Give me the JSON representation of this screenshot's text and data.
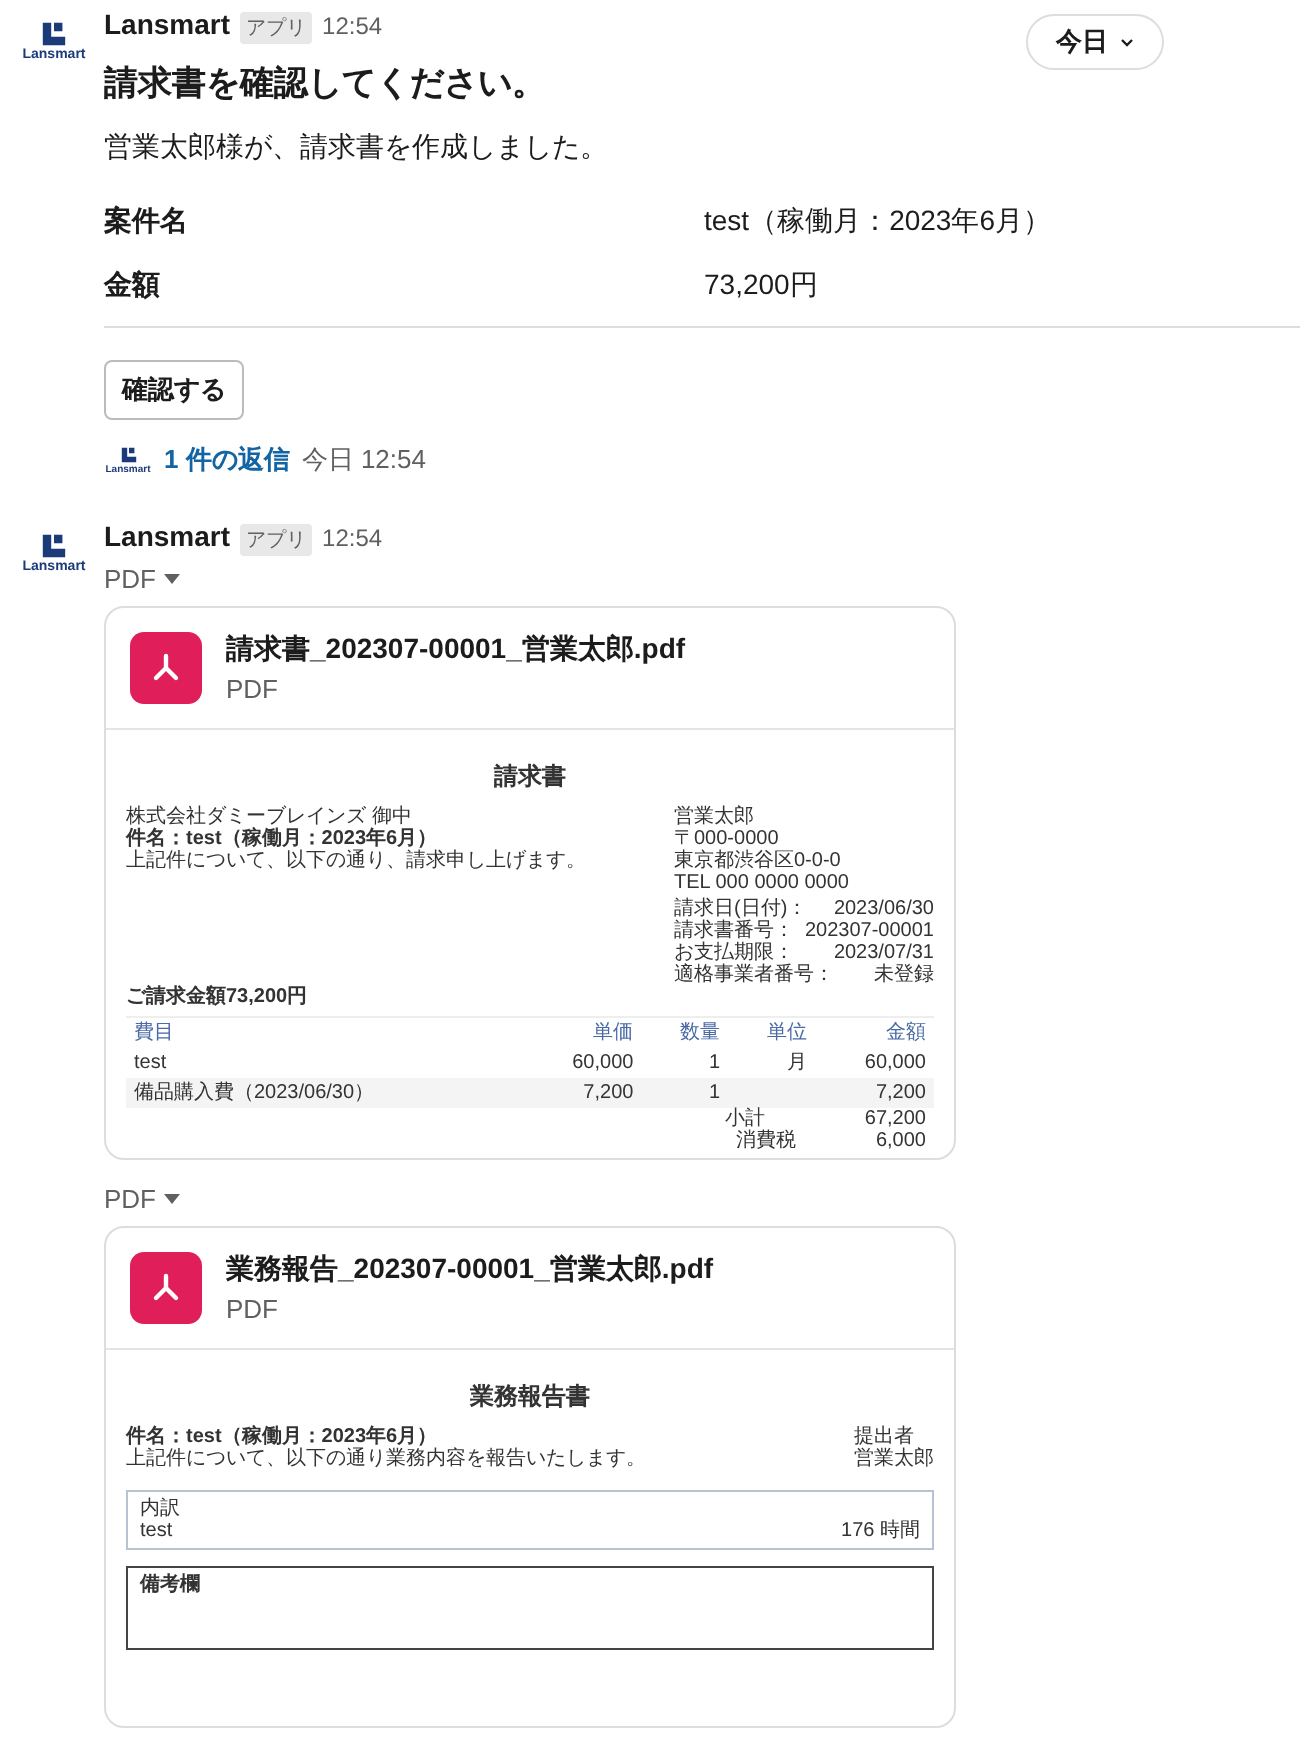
{
  "date_divider": {
    "label": "今日"
  },
  "messages": [
    {
      "sender": "Lansmart",
      "badge": "アプリ",
      "time": "12:54",
      "avatar_text": "Lansmart",
      "title": "請求書を確認してください。",
      "body": "営業太郎様が、請求書を作成しました。",
      "fields": [
        {
          "label": "案件名",
          "value": "test（稼働月：2023年6月）"
        },
        {
          "label": "金額",
          "value": "73,200円"
        }
      ],
      "button": "確認する",
      "thread": {
        "avatar_text": "Lansmart",
        "replies": "1 件の返信",
        "time": "今日 12:54"
      }
    },
    {
      "sender": "Lansmart",
      "badge": "アプリ",
      "time": "12:54",
      "avatar_text": "Lansmart",
      "attachments": [
        {
          "group_label": "PDF",
          "name": "請求書_202307-00001_営業太郎.pdf",
          "type": "PDF",
          "preview": {
            "kind": "invoice",
            "title": "請求書",
            "recipient": "株式会社ダミーブレインズ 御中",
            "subject": "件名：test（稼働月：2023年6月）",
            "note": "上記件について、以下の通り、請求申し上げます。",
            "issuer_lines": [
              "営業太郎",
              "〒000-0000",
              "東京都渋谷区0-0-0",
              "TEL 000 0000 0000"
            ],
            "details": [
              {
                "label": "請求日(日付)：",
                "value": "2023/06/30"
              },
              {
                "label": "請求書番号：",
                "value": "202307-00001"
              },
              {
                "label": "お支払期限：",
                "value": "2023/07/31"
              },
              {
                "label": "適格事業者番号：",
                "value": "未登録"
              }
            ],
            "total": "ご請求金額73,200円",
            "columns": [
              "費目",
              "単価",
              "数量",
              "単位",
              "金額"
            ],
            "rows": [
              {
                "item": "test",
                "unit_price": "60,000",
                "quantity": "1",
                "unit": "月",
                "amount": "60,000"
              },
              {
                "item": "備品購入費（2023/06/30）",
                "unit_price": "7,200",
                "quantity": "1",
                "amount": "7,200"
              }
            ],
            "summary": [
              {
                "label": "小計",
                "value": "67,200"
              },
              {
                "label": "消費税",
                "value": "6,000"
              }
            ]
          }
        },
        {
          "group_label": "PDF",
          "name": "業務報告_202307-00001_営業太郎.pdf",
          "type": "PDF",
          "preview": {
            "kind": "report",
            "title": "業務報告書",
            "subject": "件名：test（稼働月：2023年6月）",
            "note": "上記件について、以下の通り業務内容を報告いたします。",
            "submitter_label": "提出者",
            "submitter": "営業太郎",
            "breakdown_label": "内訳",
            "rows": [
              {
                "item": "test",
                "hours": "176 時間"
              }
            ],
            "remarks_label": "備考欄"
          }
        }
      ]
    }
  ]
}
